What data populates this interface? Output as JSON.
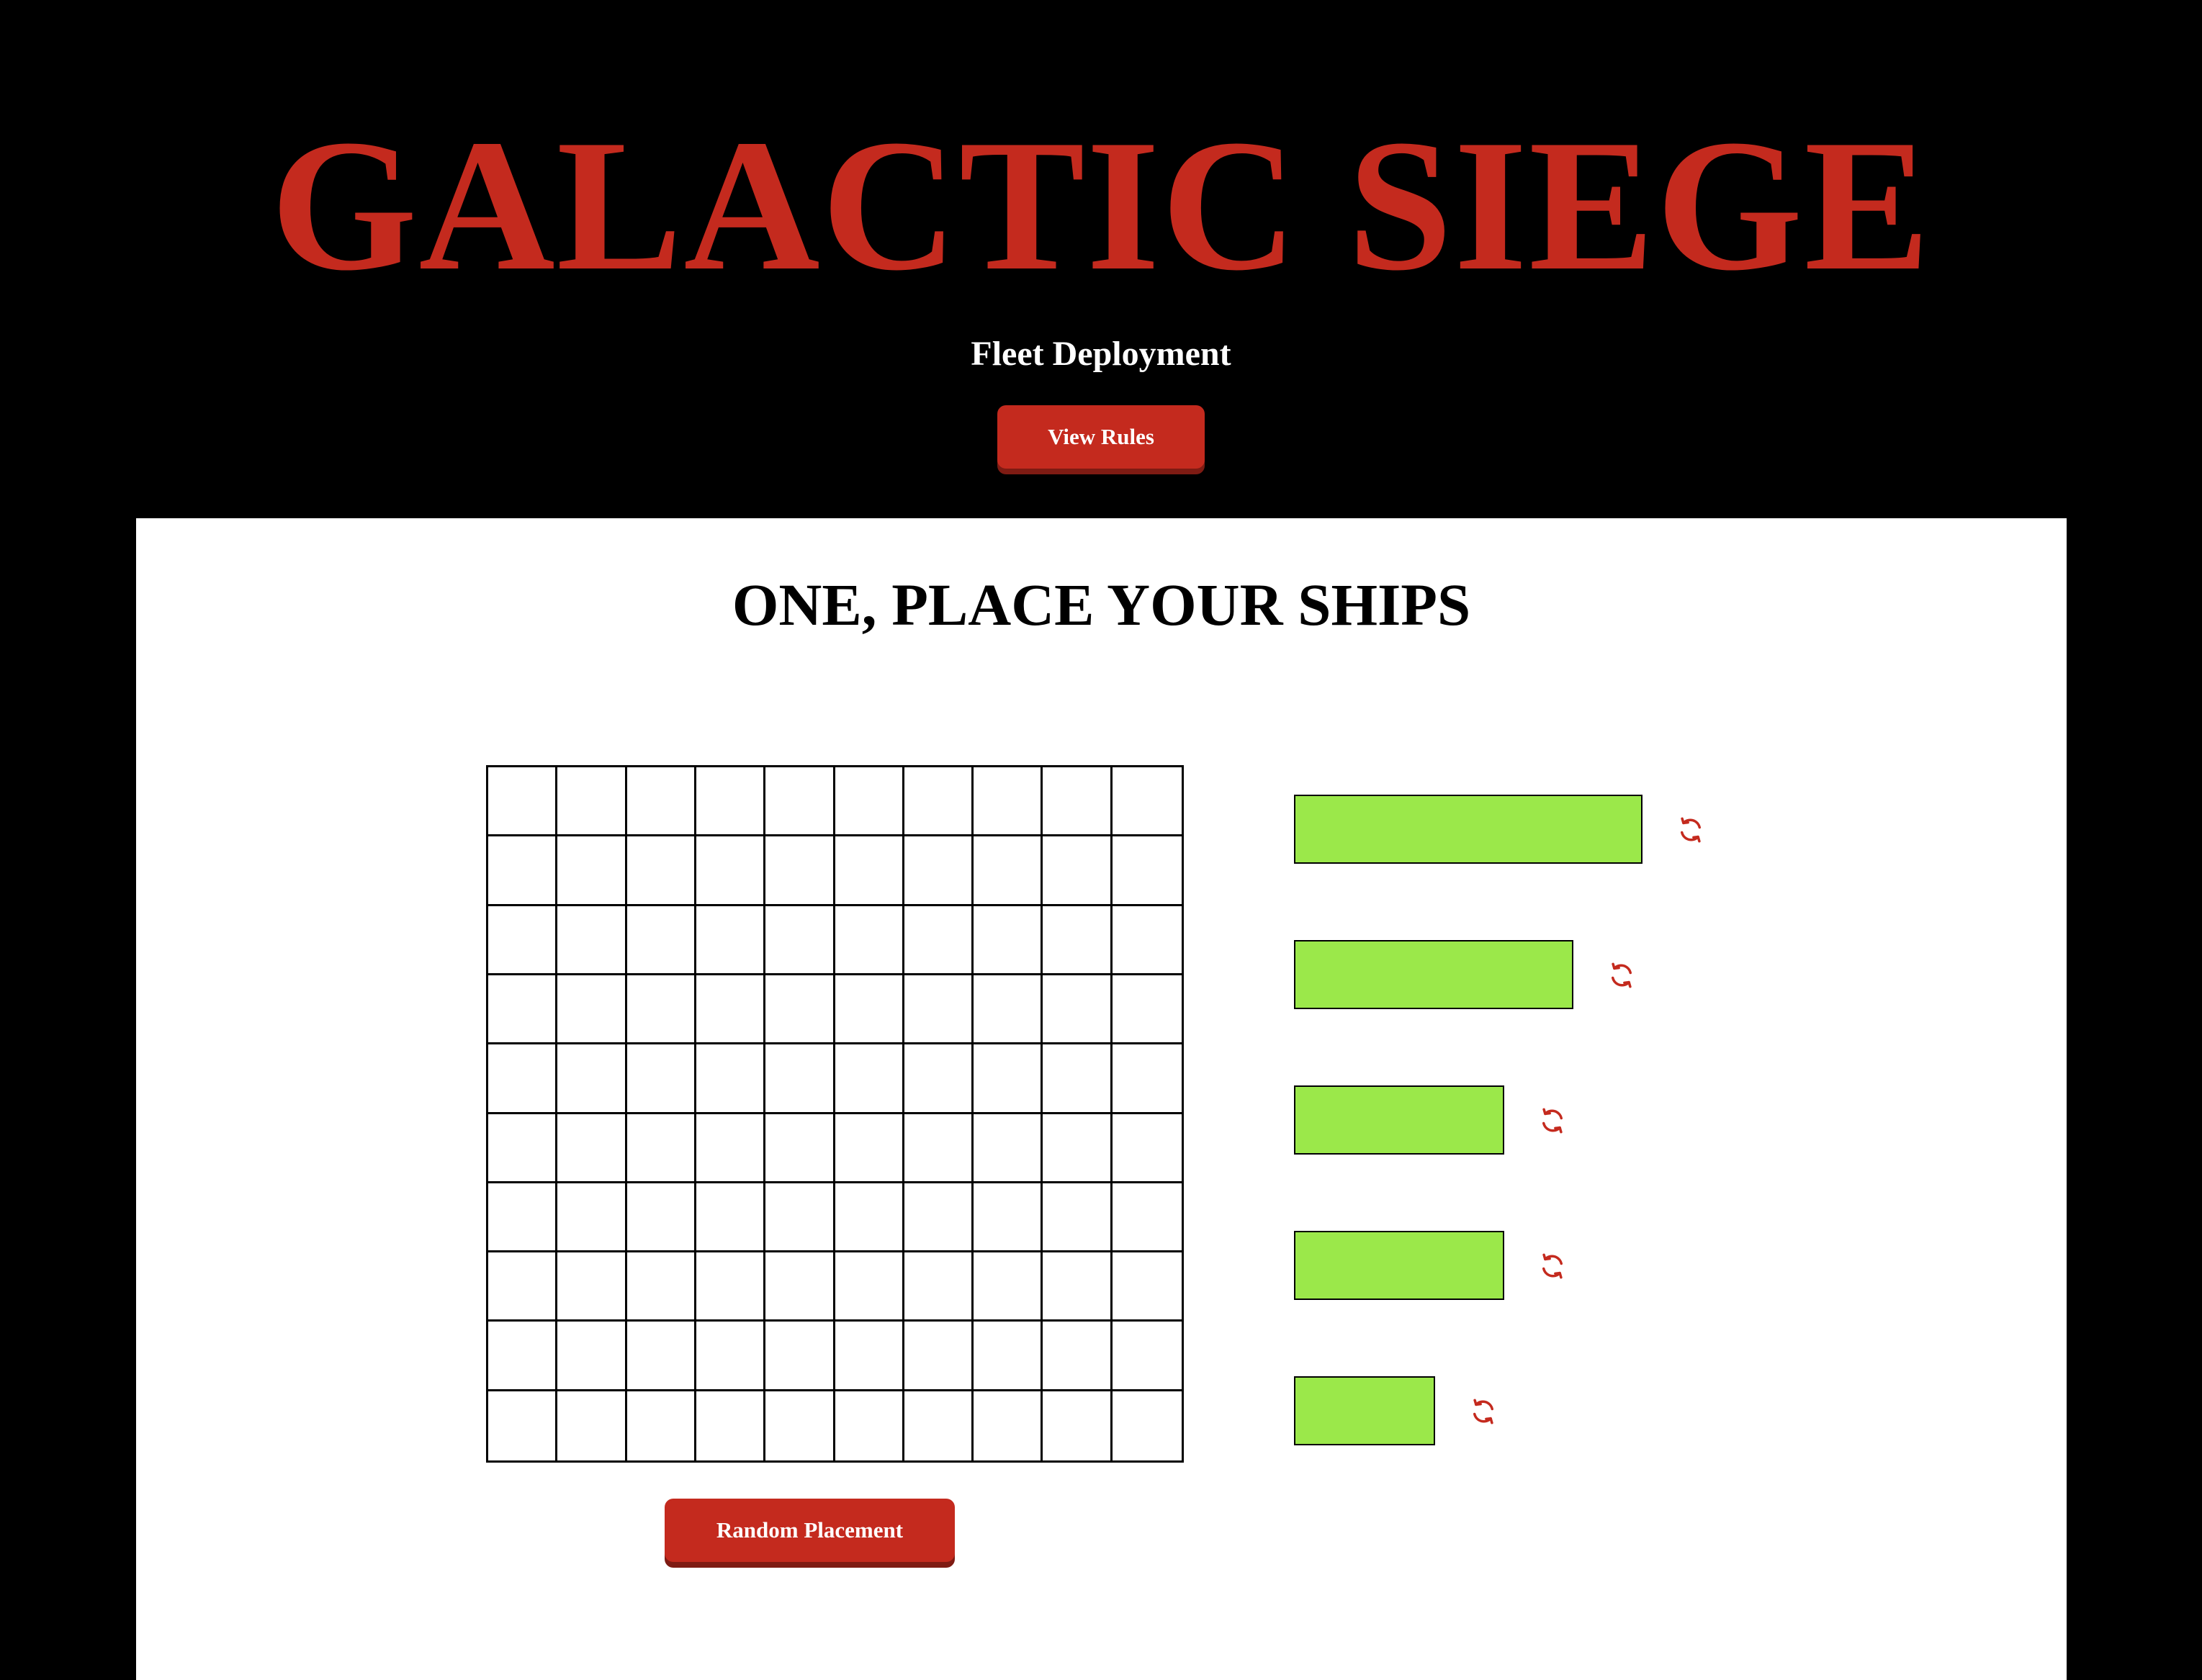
{
  "header": {
    "title": "GALACTIC SIEGE",
    "subtitle": "Fleet Deployment",
    "rules_button_label": "View Rules"
  },
  "placement": {
    "instruction": "ONE, PLACE YOUR SHIPS",
    "board": {
      "rows": 10,
      "columns": 10
    },
    "random_button_label": "Random Placement",
    "ships": [
      {
        "length": 5,
        "color": "#9be84a",
        "rotate_icon": "rotate-icon"
      },
      {
        "length": 4,
        "color": "#9be84a",
        "rotate_icon": "rotate-icon"
      },
      {
        "length": 3,
        "color": "#9be84a",
        "rotate_icon": "rotate-icon"
      },
      {
        "length": 3,
        "color": "#9be84a",
        "rotate_icon": "rotate-icon"
      },
      {
        "length": 2,
        "color": "#9be84a",
        "rotate_icon": "rotate-icon"
      }
    ]
  },
  "colors": {
    "accent": "#c42a1e",
    "background": "#000000",
    "panel": "#ffffff",
    "ship": "#9be84a"
  }
}
